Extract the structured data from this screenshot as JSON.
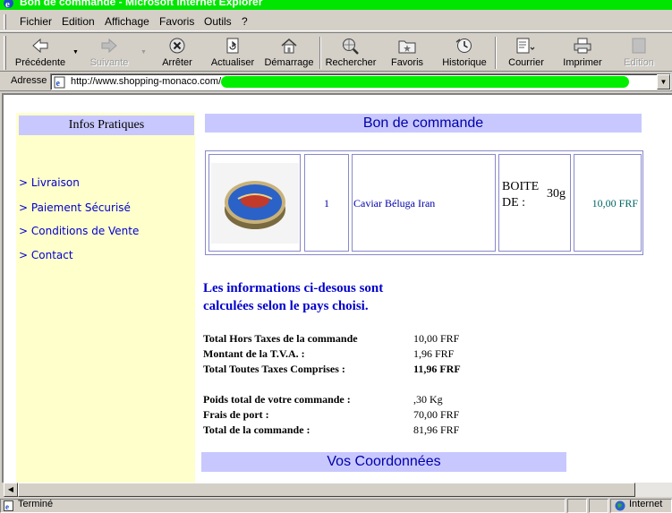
{
  "window": {
    "title": "Bon de commande - Microsoft Internet Explorer"
  },
  "menu": {
    "items": [
      {
        "label": "Fichier"
      },
      {
        "label": "Edition"
      },
      {
        "label": "Affichage"
      },
      {
        "label": "Favoris"
      },
      {
        "label": "Outils"
      },
      {
        "label": "?"
      }
    ]
  },
  "toolbar": {
    "back": "Précédente",
    "forward": "Suivante",
    "stop": "Arrêter",
    "refresh": "Actualiser",
    "home": "Démarrage",
    "search": "Rechercher",
    "favorites": "Favoris",
    "history": "Historique",
    "mail": "Courrier",
    "print": "Imprimer",
    "edit": "Edition"
  },
  "address": {
    "label": "Adresse",
    "url": "http://www.shopping-monaco.com/"
  },
  "sidebar": {
    "title": "Infos Pratiques",
    "items": [
      {
        "label": "> Livraison"
      },
      {
        "label": "> Paiement Sécurisé"
      },
      {
        "label": "> Conditions de Vente"
      },
      {
        "label": "> Contact"
      }
    ]
  },
  "order": {
    "title": "Bon de commande",
    "quantity": "1",
    "product_name": "Caviar Béluga Iran",
    "packaging_line1": "BOITE",
    "packaging_line2": "DE :",
    "packaging_size": "30g",
    "price": "10,00 FRF"
  },
  "info": {
    "line1": "Les informations ci-desous sont",
    "line2": "calculées selon le pays choisi."
  },
  "totals": {
    "ht_label": "Total Hors Taxes de la commande",
    "ht_value": "10,00 FRF",
    "tva_label": "Montant de la T.V.A. :",
    "tva_value": "1,96 FRF",
    "ttc_label": "Total Toutes Taxes Comprises :",
    "ttc_value": "11,96 FRF",
    "weight_label": "Poids total de votre commande :",
    "weight_value": ",30 Kg",
    "shipping_label": "Frais de port :",
    "shipping_value": "70,00 FRF",
    "grand_label": "Total de la commande :",
    "grand_value": "81,96 FRF"
  },
  "coords": {
    "title": "Vos Coordonnées"
  },
  "status": {
    "text": "Terminé",
    "zone": "Internet"
  },
  "colors": {
    "title_bar": "#00e600",
    "section_header": "#c8c8ff",
    "sidebar_bg": "#ffffcc",
    "link": "#0000cc"
  }
}
